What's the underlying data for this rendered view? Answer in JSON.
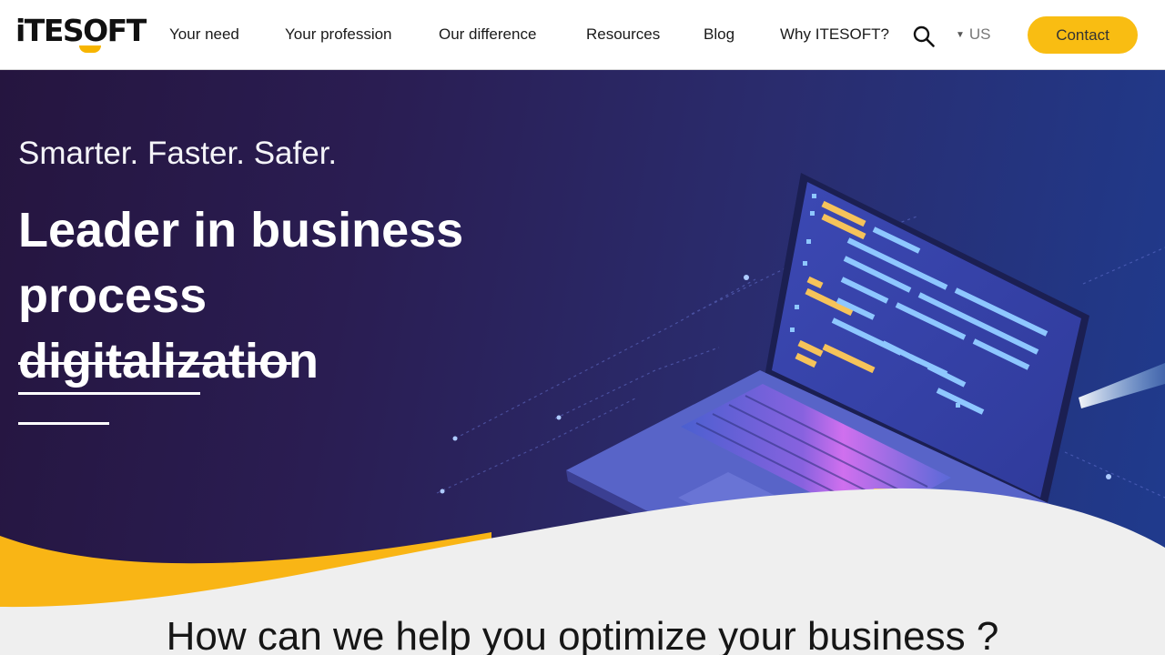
{
  "header": {
    "logo_text": "iTESOFT",
    "nav": [
      {
        "label": "Your need"
      },
      {
        "label": "Your profession"
      },
      {
        "label": "Our difference"
      },
      {
        "label": "Resources"
      },
      {
        "label": "Blog"
      },
      {
        "label": "Why ITESOFT?"
      }
    ],
    "search_icon": "search-icon",
    "language": "US",
    "contact_label": "Contact"
  },
  "hero": {
    "tagline": "Smarter. Faster. Safer.",
    "headline_line1": "Leader in business process",
    "headline_line2": "digitalization"
  },
  "section": {
    "title": "How can we help you optimize your business ?"
  },
  "colors": {
    "accent": "#f9bd12",
    "hero_dark": "#25153f",
    "hero_blue": "#1f3b8e",
    "section_bg": "#efefef"
  }
}
